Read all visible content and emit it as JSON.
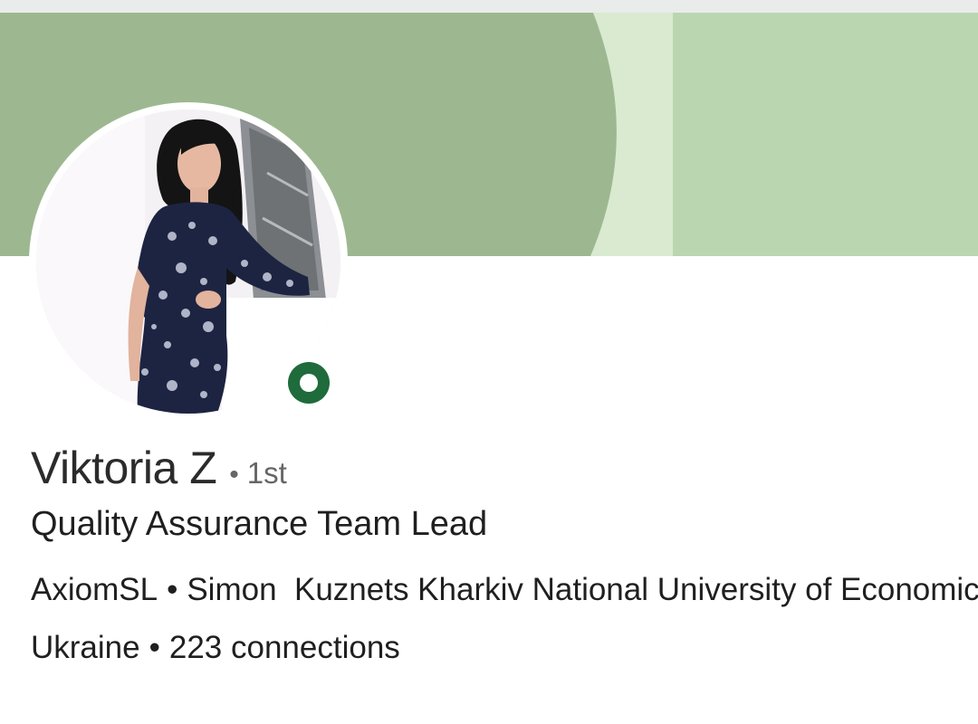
{
  "colors": {
    "banner_left": "#9db890",
    "banner_band": "#d9ead1",
    "banner_right": "#bad6b0",
    "presence_green": "#1f6b3b",
    "text_primary": "#1f1f1f",
    "text_secondary": "#666666"
  },
  "profile": {
    "name": "Viktoria Z",
    "degree_separator": "•",
    "degree": "1st",
    "headline": "Quality Assurance Team Lead",
    "company": "AxiomSL",
    "org_separator": "•",
    "school": "Simon  Kuznets Kharkiv National University of Economics",
    "location": "Ukraine",
    "location_separator": "•",
    "connections": "223 connections"
  },
  "icons": {
    "presence": "online-status-ring-icon"
  }
}
